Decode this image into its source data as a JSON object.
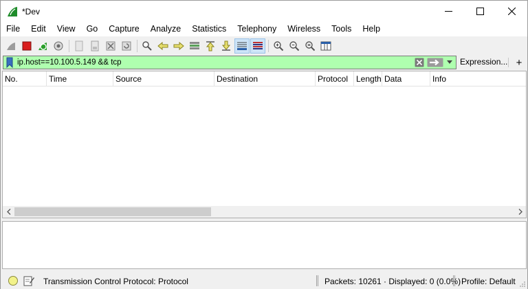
{
  "window": {
    "title": "*Dev"
  },
  "menu": [
    "File",
    "Edit",
    "View",
    "Go",
    "Capture",
    "Analyze",
    "Statistics",
    "Telephony",
    "Wireless",
    "Tools",
    "Help"
  ],
  "filter": {
    "value": "ip.host==10.100.5.149 && tcp",
    "expression_label": "Expression...",
    "plus_label": "+"
  },
  "columns": [
    "No.",
    "Time",
    "Source",
    "Destination",
    "Protocol",
    "Length",
    "Data",
    "Info"
  ],
  "status": {
    "field_text": "Transmission Control Protocol: Protocol",
    "packets_text": "Packets: 10261 · Displayed: 0 (0.0%)",
    "profile_text": "Profile: Default"
  },
  "colors": {
    "filter_valid_bg": "#afffaf",
    "accent": "#2ca02c"
  },
  "icons": {
    "toolbar": [
      "shark-fin-start-icon",
      "stop-capture-icon",
      "restart-capture-icon",
      "capture-options-icon",
      "open-file-icon",
      "save-file-icon",
      "close-file-icon",
      "reload-file-icon",
      "find-packet-icon",
      "go-back-icon",
      "go-forward-icon",
      "go-to-packet-icon",
      "go-first-icon",
      "go-last-icon",
      "autoscroll-icon",
      "colorize-icon",
      "zoom-in-icon",
      "zoom-out-icon",
      "zoom-normal-icon",
      "resize-columns-icon"
    ]
  }
}
